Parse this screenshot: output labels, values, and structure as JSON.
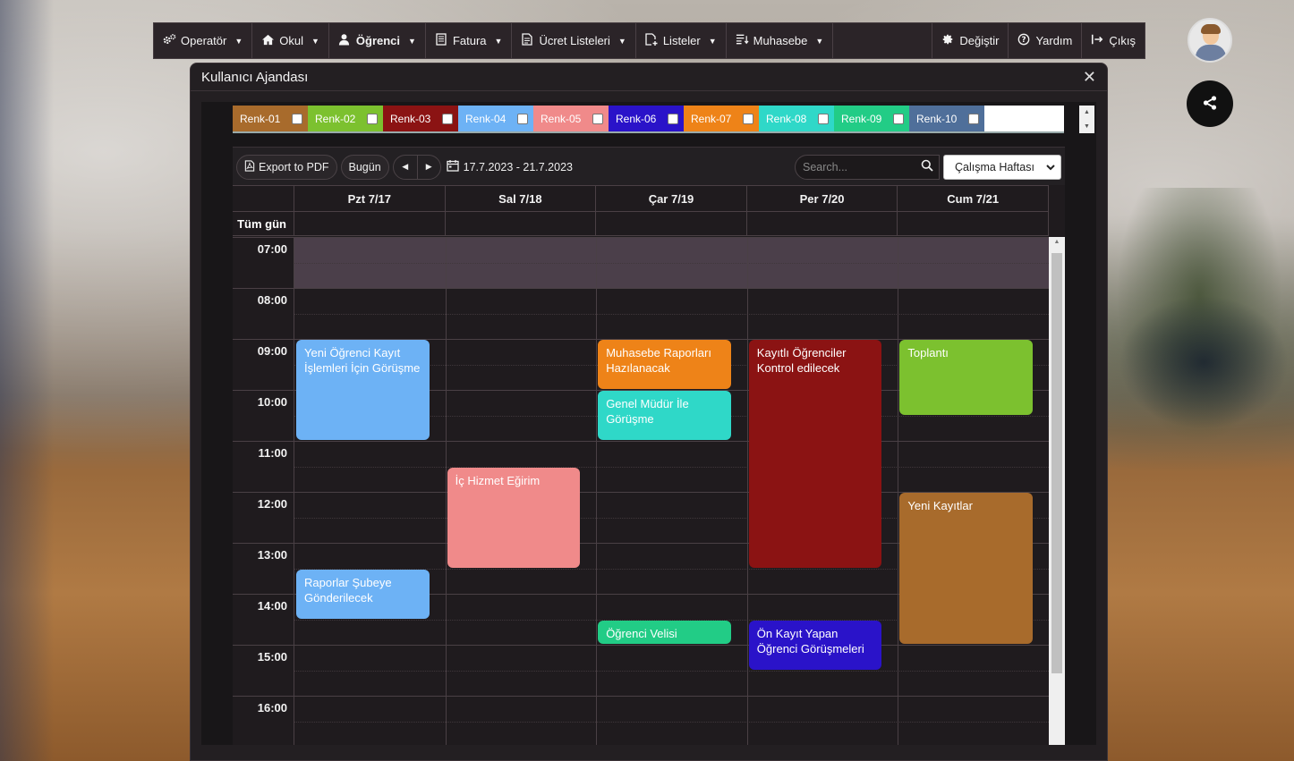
{
  "nav": {
    "items": [
      {
        "label": "Operatör",
        "icon": "gears-icon",
        "name": "nav-operator",
        "bold": false
      },
      {
        "label": "Okul",
        "icon": "home-icon",
        "name": "nav-okul",
        "bold": false
      },
      {
        "label": "Öğrenci",
        "icon": "user-icon",
        "name": "nav-ogrenci",
        "bold": true
      },
      {
        "label": "Fatura",
        "icon": "invoice-icon",
        "name": "nav-fatura",
        "bold": false
      },
      {
        "label": "Ücret Listeleri",
        "icon": "list-icon",
        "name": "nav-ucret-listeleri",
        "bold": false
      },
      {
        "label": "Listeler",
        "icon": "document-add-icon",
        "name": "nav-listeler",
        "bold": false
      },
      {
        "label": "Muhasebe",
        "icon": "list-sort-icon",
        "name": "nav-muhasebe",
        "bold": false
      }
    ],
    "right": {
      "change": "Değiştir",
      "help": "Yardım",
      "logout": "Çıkış"
    }
  },
  "modal": {
    "title": "Kullanıcı Ajandası"
  },
  "legend": [
    {
      "label": "Renk-01",
      "color": "#a86b2c"
    },
    {
      "label": "Renk-02",
      "color": "#7cc12f"
    },
    {
      "label": "Renk-03",
      "color": "#8b1313"
    },
    {
      "label": "Renk-04",
      "color": "#6db2f5"
    },
    {
      "label": "Renk-05",
      "color": "#f08a8a"
    },
    {
      "label": "Renk-06",
      "color": "#2a13c9"
    },
    {
      "label": "Renk-07",
      "color": "#ee8318"
    },
    {
      "label": "Renk-08",
      "color": "#2fd8c8"
    },
    {
      "label": "Renk-09",
      "color": "#22cc86"
    },
    {
      "label": "Renk-10",
      "color": "#4f6f9a"
    }
  ],
  "toolbar": {
    "export_label": "Export to PDF",
    "today_label": "Bugün",
    "date_range": "17.7.2023 - 21.7.2023",
    "search_placeholder": "Search...",
    "view_selected": "Çalışma Haftası"
  },
  "calendar": {
    "days": [
      "Pzt 7/17",
      "Sal 7/18",
      "Çar 7/19",
      "Per 7/20",
      "Cum 7/21"
    ],
    "allday_label": "Tüm gün",
    "hours": [
      "07:00",
      "08:00",
      "09:00",
      "10:00",
      "11:00",
      "12:00",
      "13:00",
      "14:00",
      "15:00",
      "16:00"
    ],
    "events": [
      {
        "title": "Yeni Öğrenci Kayıt İşlemleri İçin Görüşme",
        "day": 0,
        "start": "09:00",
        "end": "11:00",
        "color": "#6db2f5"
      },
      {
        "title": "Raporlar Şubeye Gönderilecek",
        "day": 0,
        "start": "13:30",
        "end": "14:30",
        "color": "#6db2f5"
      },
      {
        "title": "İç Hizmet Eğirim",
        "day": 1,
        "start": "11:30",
        "end": "13:30",
        "color": "#f08a8a"
      },
      {
        "title": "Muhasebe Raporları Hazılanacak",
        "day": 2,
        "start": "09:00",
        "end": "10:00",
        "color": "#ee8318"
      },
      {
        "title": "Genel Müdür İle Görüşme",
        "day": 2,
        "start": "10:00",
        "end": "11:00",
        "color": "#2fd8c8"
      },
      {
        "title": "Öğrenci Velisi",
        "day": 2,
        "start": "14:30",
        "end": "15:00",
        "color": "#22cc86"
      },
      {
        "title": "Kayıtlı Öğrenciler Kontrol edilecek",
        "day": 3,
        "start": "09:00",
        "end": "13:30",
        "color": "#8b1313"
      },
      {
        "title": "Ön Kayıt Yapan Öğrenci Görüşmeleri",
        "day": 3,
        "start": "14:30",
        "end": "15:30",
        "color": "#2a13c9"
      },
      {
        "title": "Toplantı",
        "day": 4,
        "start": "09:00",
        "end": "10:30",
        "color": "#7cc12f"
      },
      {
        "title": "Yeni Kayıtlar",
        "day": 4,
        "start": "12:00",
        "end": "15:00",
        "color": "#a86b2c"
      }
    ]
  }
}
